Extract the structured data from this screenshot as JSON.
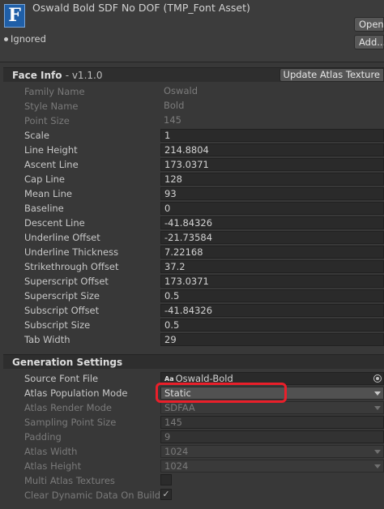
{
  "header": {
    "logo_letter": "F",
    "title": "Oswald Bold SDF No DOF (TMP_Font Asset)",
    "open_label": "Open",
    "add_label": "Add...",
    "ignored_label": "Ignored"
  },
  "face_info": {
    "title": "Face Info",
    "version": "- v1.1.0",
    "update_button": "Update Atlas Texture",
    "rows": [
      {
        "label": "Family Name",
        "value": "Oswald"
      },
      {
        "label": "Style Name",
        "value": "Bold"
      },
      {
        "label": "Point Size",
        "value": "145"
      },
      {
        "label": "Scale",
        "value": "1"
      },
      {
        "label": "Line Height",
        "value": "214.8804"
      },
      {
        "label": "Ascent Line",
        "value": "173.0371"
      },
      {
        "label": "Cap Line",
        "value": "128"
      },
      {
        "label": "Mean Line",
        "value": "93"
      },
      {
        "label": "Baseline",
        "value": "0"
      },
      {
        "label": "Descent Line",
        "value": "-41.84326"
      },
      {
        "label": "Underline Offset",
        "value": "-21.73584"
      },
      {
        "label": "Underline Thickness",
        "value": "7.22168"
      },
      {
        "label": "Strikethrough Offset",
        "value": "37.2"
      },
      {
        "label": "Superscript Offset",
        "value": "173.0371"
      },
      {
        "label": "Superscript Size",
        "value": "0.5"
      },
      {
        "label": "Subscript Offset",
        "value": "-41.84326"
      },
      {
        "label": "Subscript Size",
        "value": "0.5"
      },
      {
        "label": "Tab Width",
        "value": "29"
      }
    ]
  },
  "generation": {
    "title": "Generation Settings",
    "source_font_file": {
      "label": "Source Font File",
      "value": "Oswald-Bold",
      "icon": "Aa"
    },
    "atlas_population_mode": {
      "label": "Atlas Population Mode",
      "value": "Static"
    },
    "atlas_render_mode": {
      "label": "Atlas Render Mode",
      "value": "SDFAA"
    },
    "sampling_point_size": {
      "label": "Sampling Point Size",
      "value": "145"
    },
    "padding": {
      "label": "Padding",
      "value": "9"
    },
    "atlas_width": {
      "label": "Atlas Width",
      "value": "1024"
    },
    "atlas_height": {
      "label": "Atlas Height",
      "value": "1024"
    },
    "multi_atlas_textures": {
      "label": "Multi Atlas Textures",
      "checked": false
    },
    "clear_dynamic_data": {
      "label": "Clear Dynamic Data On Build",
      "checked": true,
      "check_glyph": "✓"
    }
  },
  "colors": {
    "background": "#383838",
    "field": "#2a2a2a",
    "highlight": "#ea1f2a",
    "logo": "#1f5fa8"
  }
}
